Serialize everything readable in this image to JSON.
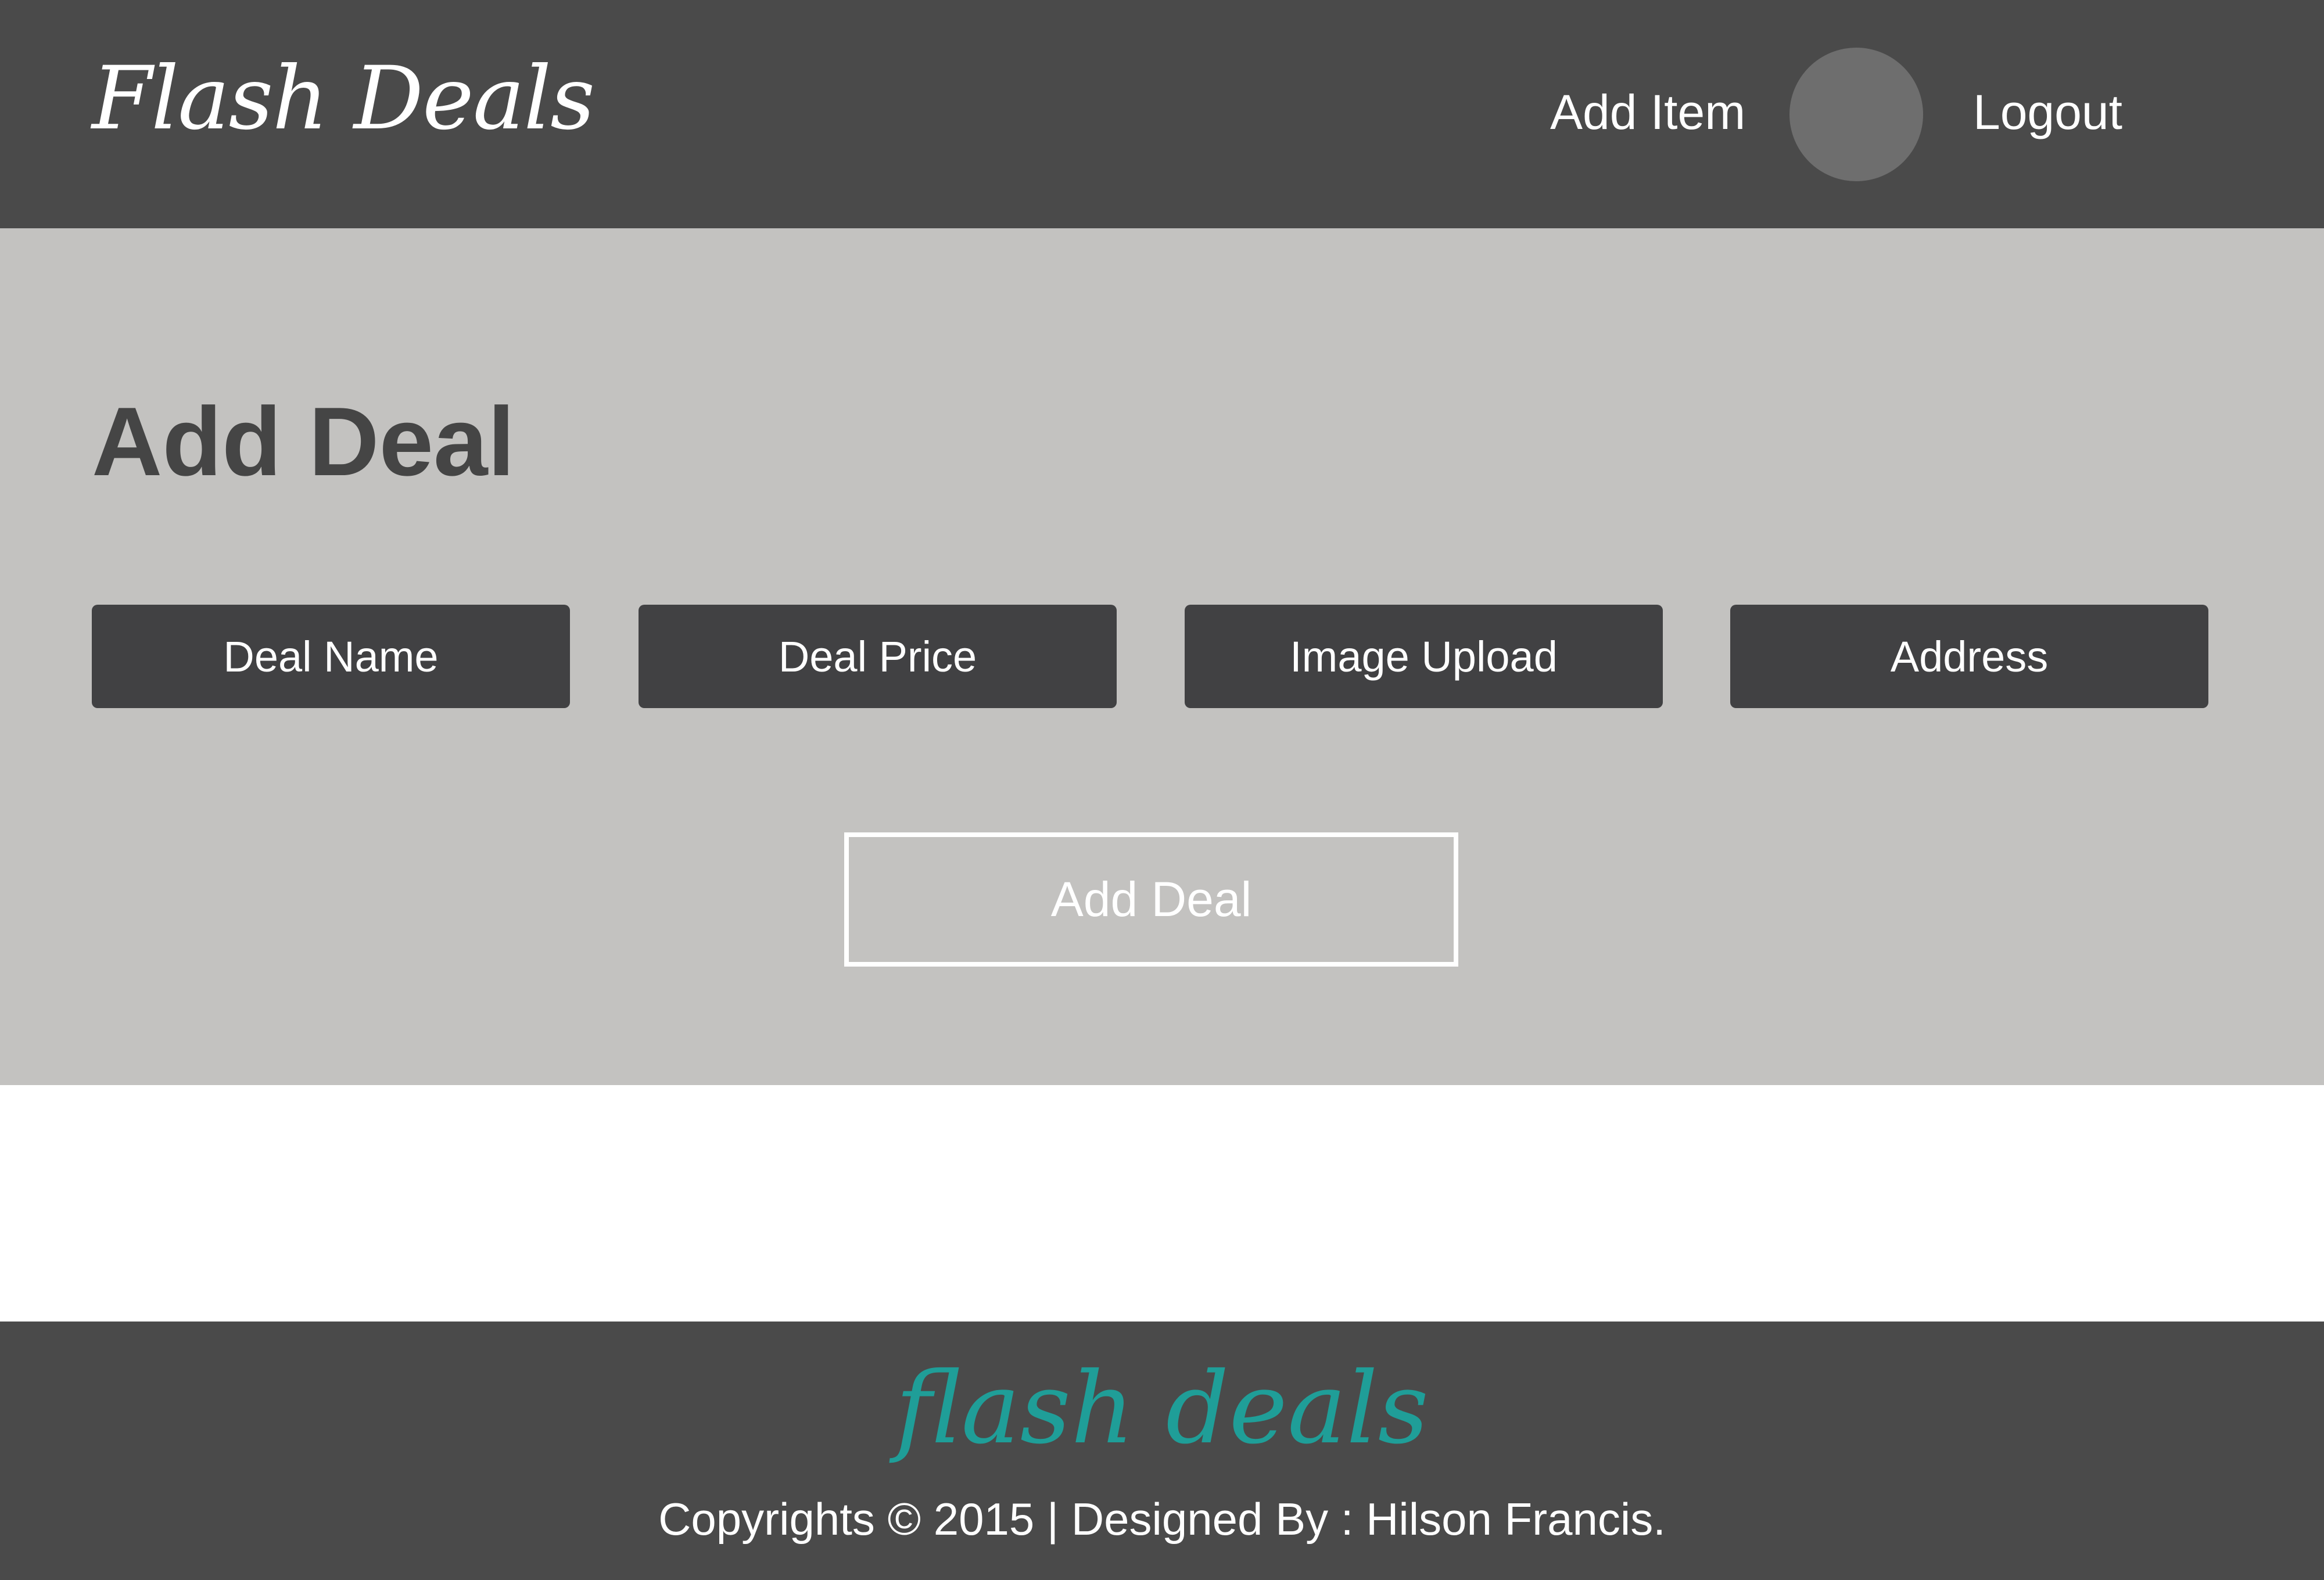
{
  "header": {
    "logo": "Flash Deals",
    "nav": {
      "add_item": "Add Item",
      "logout": "Logout"
    }
  },
  "main": {
    "title": "Add Deal",
    "fields": [
      {
        "placeholder": "Deal Name"
      },
      {
        "placeholder": "Deal Price"
      },
      {
        "placeholder": "Image Upload"
      },
      {
        "placeholder": "Address"
      }
    ],
    "submit_label": "Add Deal"
  },
  "footer": {
    "logo": "flash deals",
    "copyright": "Copyrights © 2015 | Designed By : Hilson Francis."
  },
  "colors": {
    "header_bg": "#4a4a4a",
    "main_bg": "#c3c2c0",
    "field_bg": "#414143",
    "footer_accent": "#1f9e98"
  }
}
